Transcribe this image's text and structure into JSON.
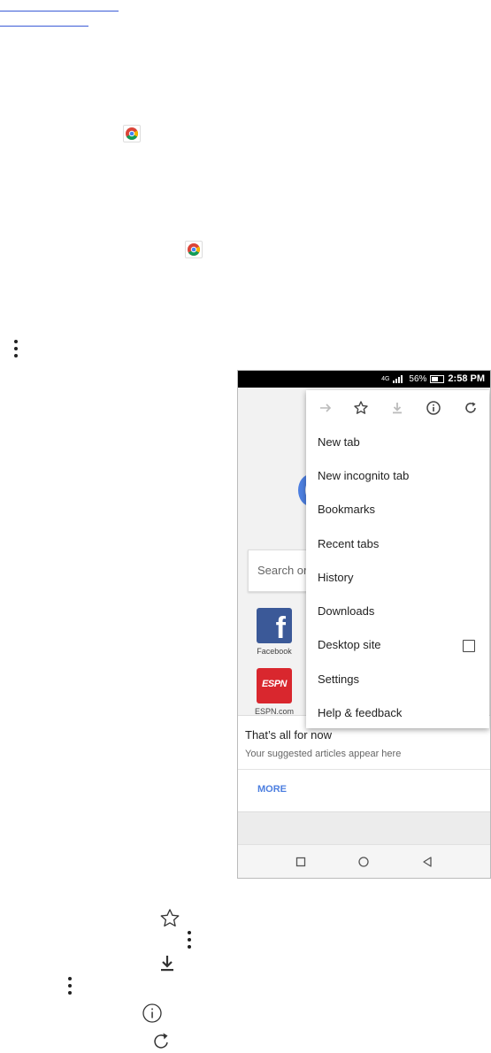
{
  "status_bar": {
    "network": "4G",
    "battery": "56%",
    "time": "2:58 PM"
  },
  "ntp": {
    "search_placeholder": "Search or",
    "tiles": [
      {
        "label": "Facebook",
        "logo_text": "f"
      },
      {
        "label": "ESPN.com",
        "logo_text": "ESPN"
      }
    ],
    "articles": {
      "title": "That’s all for now",
      "subtitle": "Your suggested articles appear here",
      "more": "MORE"
    }
  },
  "menu": {
    "icons": [
      "forward-icon",
      "bookmark-star-icon",
      "download-icon",
      "info-icon",
      "reload-icon"
    ],
    "items": [
      {
        "label": "New tab"
      },
      {
        "label": "New incognito tab"
      },
      {
        "label": "Bookmarks"
      },
      {
        "label": "Recent tabs"
      },
      {
        "label": "History"
      },
      {
        "label": "Downloads"
      },
      {
        "label": "Desktop site",
        "checkbox": false
      },
      {
        "label": "Settings"
      },
      {
        "label": "Help & feedback"
      }
    ]
  },
  "nav_bar": {
    "buttons": [
      "recents-button",
      "home-button",
      "back-button"
    ]
  },
  "colors": {
    "accent": "#4d7fe0",
    "facebook": "#3b5998",
    "espn": "#d9272e"
  }
}
